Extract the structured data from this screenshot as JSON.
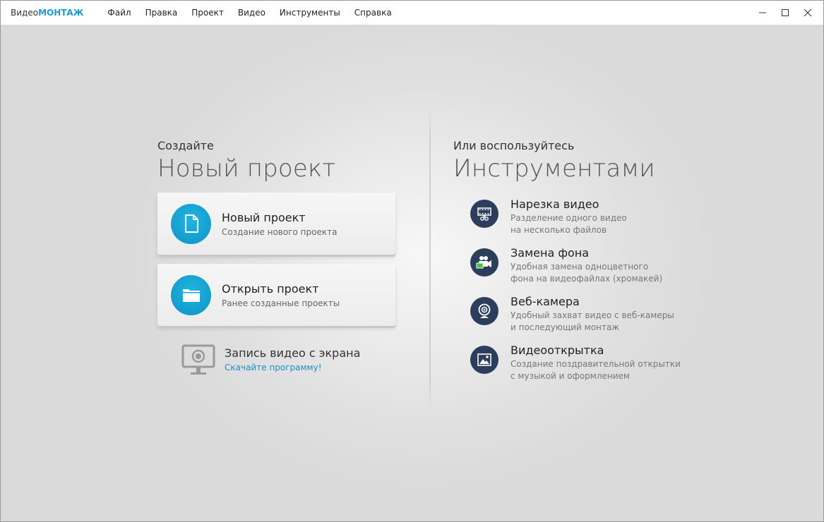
{
  "app": {
    "brand_part1": "Видео",
    "brand_part2": "МОНТАЖ",
    "accent_color": "#1a9bd1"
  },
  "menu": [
    {
      "label": "Файл"
    },
    {
      "label": "Правка"
    },
    {
      "label": "Проект"
    },
    {
      "label": "Видео"
    },
    {
      "label": "Инструменты"
    },
    {
      "label": "Справка"
    }
  ],
  "window_controls": [
    "minimize-icon",
    "maximize-icon",
    "close-icon"
  ],
  "left": {
    "kicker": "Создайте",
    "title": "Новый проект",
    "cards": [
      {
        "title": "Новый проект",
        "subtitle": "Создание нового проекта",
        "icon": "document-icon"
      },
      {
        "title": "Открыть проект",
        "subtitle": "Ранее созданные проекты",
        "icon": "folder-icon"
      }
    ],
    "screen_record": {
      "title": "Запись видео с экрана",
      "link": "Скачайте программу!",
      "icon": "monitor-record-icon"
    }
  },
  "right": {
    "kicker": "Или воспользуйтесь",
    "title": "Инструментами",
    "tools": [
      {
        "title": "Нарезка видео",
        "line1": "Разделение одного видео",
        "line2": "на несколько файлов",
        "icon": "film-scissors-icon"
      },
      {
        "title": "Замена фона",
        "line1": "Удобная замена одноцветного",
        "line2": "фона на видеофайлах (хромакей)",
        "icon": "camera-chromakey-icon"
      },
      {
        "title": "Веб-камера",
        "line1": "Удобный захват видео с веб-камеры",
        "line2": "и последующий монтаж",
        "icon": "webcam-icon"
      },
      {
        "title": "Видеооткрытка",
        "line1": "Создание поздравительной открытки",
        "line2": "с музыкой и оформлением",
        "icon": "picture-icon"
      }
    ]
  }
}
